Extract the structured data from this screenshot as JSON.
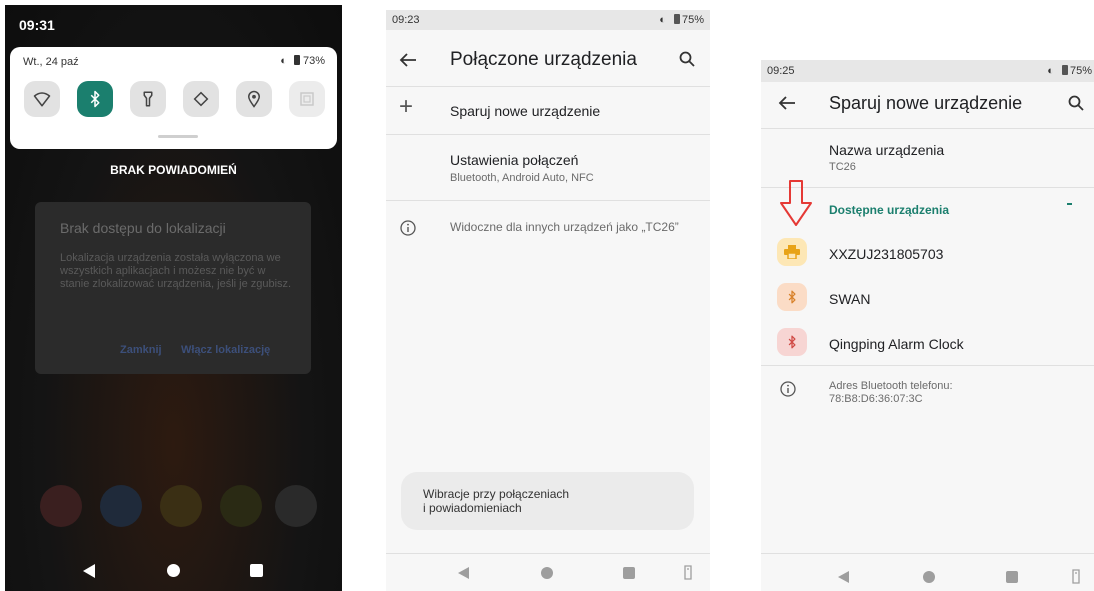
{
  "phone1": {
    "status_time": "09:31",
    "qs_date": "Wt., 24 paź",
    "qs_battery": "73%",
    "qs_tiles": [
      "wifi-icon",
      "bluetooth-icon",
      "flashlight-icon",
      "rotate-icon",
      "location-icon",
      "qr-icon"
    ],
    "no_notifications": "BRAK POWIADOMIEŃ",
    "dialog": {
      "title": "Brak dostępu do lokalizacji",
      "body": "Lokalizacja urządzenia została wyłączona we wszystkich aplikacjach i możesz nie być w stanie zlokalizować urządzenia, jeśli je zgubisz.",
      "close": "Zamknij",
      "enable": "Włącz lokalizację"
    }
  },
  "phone2": {
    "status_time": "09:23",
    "status_battery": "75%",
    "title": "Połączone urządzenia",
    "pair_new": "Sparuj nowe urządzenie",
    "connection_settings": {
      "title": "Ustawienia połączeń",
      "subtitle": "Bluetooth, Android Auto, NFC"
    },
    "visible_as": "Widoczne dla innych urządzeń jako „TC26”",
    "vibration_card": {
      "line1": "Wibracje przy połączeniach",
      "line2": "i powiadomieniach"
    }
  },
  "phone3": {
    "status_time": "09:25",
    "status_battery": "75%",
    "title": "Sparuj nowe urządzenie",
    "device_name_label": "Nazwa urządzenia",
    "device_name_value": "TC26",
    "available_header": "Dostępne urządzenia",
    "devices": [
      {
        "name": "XXZUJ231805703",
        "icon": "printer-icon",
        "bg": "#fde7b5",
        "fg": "#e8a317"
      },
      {
        "name": "SWAN",
        "icon": "bluetooth-icon",
        "bg": "#fbdcc6",
        "fg": "#d9822b"
      },
      {
        "name": "Qingping Alarm Clock",
        "icon": "bluetooth-icon",
        "bg": "#f7d5d3",
        "fg": "#d04a45"
      }
    ],
    "bt_address_label": "Adres Bluetooth telefonu:",
    "bt_address_value": "78:B8:D6:36:07:3C"
  },
  "colors": {
    "accent_teal": "#1b7f6e",
    "annotation_arrow": "#e53935"
  }
}
